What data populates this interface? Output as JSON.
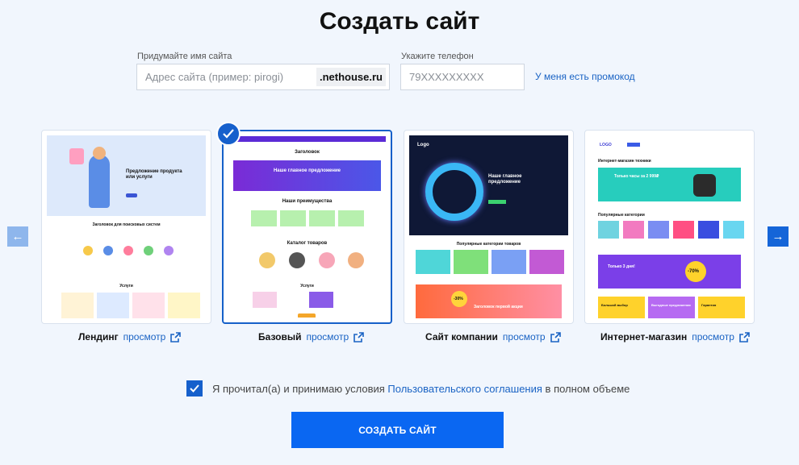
{
  "page": {
    "title": "Создать сайт"
  },
  "form": {
    "site_name_label": "Придумайте имя сайта",
    "site_name_placeholder": "Адрес сайта (пример: pirogi)",
    "domain_suffix": ".nethouse.ru",
    "phone_label": "Укажите телефон",
    "phone_placeholder": "79XXXXXXXXX",
    "promo_link": "У меня есть промокод"
  },
  "templates": [
    {
      "name": "Лендинг",
      "preview_label": "просмотр",
      "selected": false,
      "thumb": {
        "headline": "Предложение продукта или услуги",
        "section": "Заголовок для поисковых систем",
        "footer_section": "Услуги"
      }
    },
    {
      "name": "Базовый",
      "preview_label": "просмотр",
      "selected": true,
      "thumb": {
        "header": "Заголовок",
        "banner": "Наше главное предложение",
        "section1": "Наши преимущества",
        "section2": "Каталог товаров",
        "section3": "Услуги"
      }
    },
    {
      "name": "Сайт компании",
      "preview_label": "просмотр",
      "selected": false,
      "thumb": {
        "logo": "Logo",
        "banner": "Наше главное предложение",
        "section": "Популярные категории товаров",
        "promo_badge": "-30%",
        "promo_text": "Заголовок первой акции"
      }
    },
    {
      "name": "Интернет-магазин",
      "preview_label": "просмотр",
      "selected": false,
      "thumb": {
        "logo": "LOGO",
        "heading": "Интернет-магазин техники",
        "banner": "Только часы за 2 999₽",
        "section": "Популярные категории",
        "promo_title": "Только 3 дня!",
        "promo_badge": "-70%",
        "tile1": "Большой выбор",
        "tile2": "Выгодные предложения",
        "tile3": "Гарантия"
      }
    }
  ],
  "agreement": {
    "prefix": "Я прочитал(а) и принимаю условия",
    "link": "Пользовательского соглашения",
    "suffix": "в полном объеме",
    "checked": true
  },
  "submit_label": "СОЗДАТЬ САЙТ",
  "colors": {
    "accent": "#0a67f2",
    "link": "#1a63c4",
    "background": "#f1f6fd"
  },
  "icons": {
    "left_arrow": "arrow-left-icon",
    "right_arrow": "arrow-right-icon",
    "external": "external-link-icon",
    "check": "checkmark-icon"
  }
}
